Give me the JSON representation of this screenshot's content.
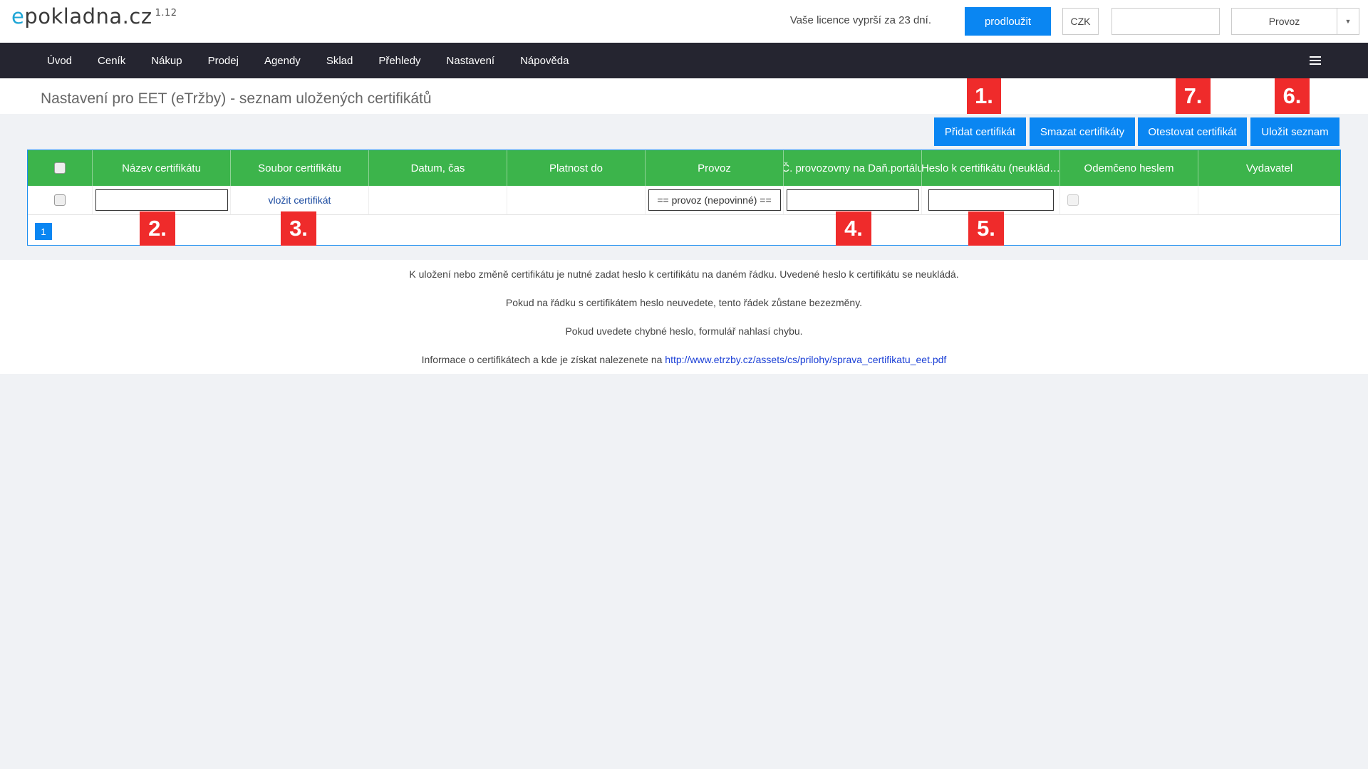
{
  "header": {
    "logo_prefix": "e",
    "logo_text": "pokladna.cz",
    "version": "1.12",
    "licence_text": "Vaše licence vyprší za 23 dní.",
    "renew_button": "prodloužit",
    "currency": "CZK",
    "provoz_select": "Provoz"
  },
  "nav": {
    "items": [
      "Úvod",
      "Ceník",
      "Nákup",
      "Prodej",
      "Agendy",
      "Sklad",
      "Přehledy",
      "Nastavení",
      "Nápověda"
    ]
  },
  "page": {
    "title": "Nastavení pro EET (eTržby) - seznam uložených certifikátů"
  },
  "toolbar": {
    "add": "Přidat certifikát",
    "delete": "Smazat certifikáty",
    "test": "Otestovat certifikát",
    "save": "Uložit seznam"
  },
  "table": {
    "columns": [
      "",
      "Název certifikátu",
      "Soubor certifikátu",
      "Datum, čas",
      "Platnost do",
      "Provoz",
      "Č. provozovny na Daň.portálu",
      "Heslo k certifikátu (neuklád…",
      "Odemčeno heslem",
      "Vydavatel"
    ],
    "row": {
      "file_link": "vložit certifikát",
      "provoz_select": "== provoz (nepovinné) =="
    },
    "page_number": "1"
  },
  "markers": [
    "1.",
    "2.",
    "3.",
    "4.",
    "5.",
    "6.",
    "7."
  ],
  "info": {
    "line1": "K uložení nebo změně certifikátu je nutné zadat heslo k certifikátu na daném řádku. Uvedené heslo k certifikátu se neukládá.",
    "line2": "Pokud na řádku s certifikátem heslo neuvedete, tento řádek zůstane bezezměny.",
    "line3": "Pokud uvedete chybné heslo, formulář nahlasí chybu.",
    "line4_prefix": "Informace o certifikátech a kde je získat nalezenete na ",
    "line4_link": "http://www.etrzby.cz/assets/cs/prilohy/sprava_certifikatu_eet.pdf"
  },
  "colors": {
    "accent_blue": "#0a86f2",
    "grid_header_green": "#3cb44b",
    "navbar_dark": "#252530",
    "marker_red": "#ef2b2b"
  }
}
